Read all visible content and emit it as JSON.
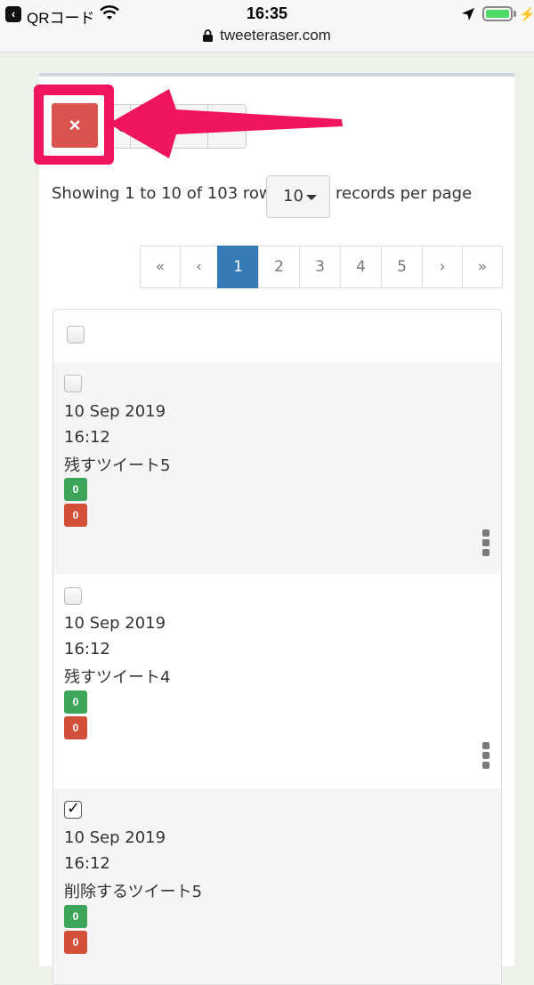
{
  "status_bar": {
    "back_app": "QRコード",
    "time": "16:35"
  },
  "url_bar": {
    "url": "tweeteraser.com"
  },
  "toolbar": {
    "delete_icon": "×"
  },
  "table_info": {
    "showing": "Showing 1 to 10 of 103 rows",
    "per_page_value": "10",
    "per_page_label": "records per page"
  },
  "pagination": {
    "items": [
      "«",
      "‹",
      "1",
      "2",
      "3",
      "4",
      "5",
      "›",
      "»"
    ],
    "active": "1"
  },
  "rows": [
    {
      "date": "10 Sep 2019",
      "time": "16:12",
      "text": "残すツイート5",
      "retweets": "0",
      "likes": "0",
      "checked": false
    },
    {
      "date": "10 Sep 2019",
      "time": "16:12",
      "text": "残すツイート4",
      "retweets": "0",
      "likes": "0",
      "checked": false
    },
    {
      "date": "10 Sep 2019",
      "time": "16:12",
      "text": "削除するツイート5",
      "retweets": "0",
      "likes": "0",
      "checked": true
    }
  ],
  "colors": {
    "highlight": "#f0135d",
    "delete_button": "#d9534f",
    "pagination_active": "#337ab7",
    "badge_green": "#3fa55a",
    "badge_red": "#d24f3a"
  }
}
